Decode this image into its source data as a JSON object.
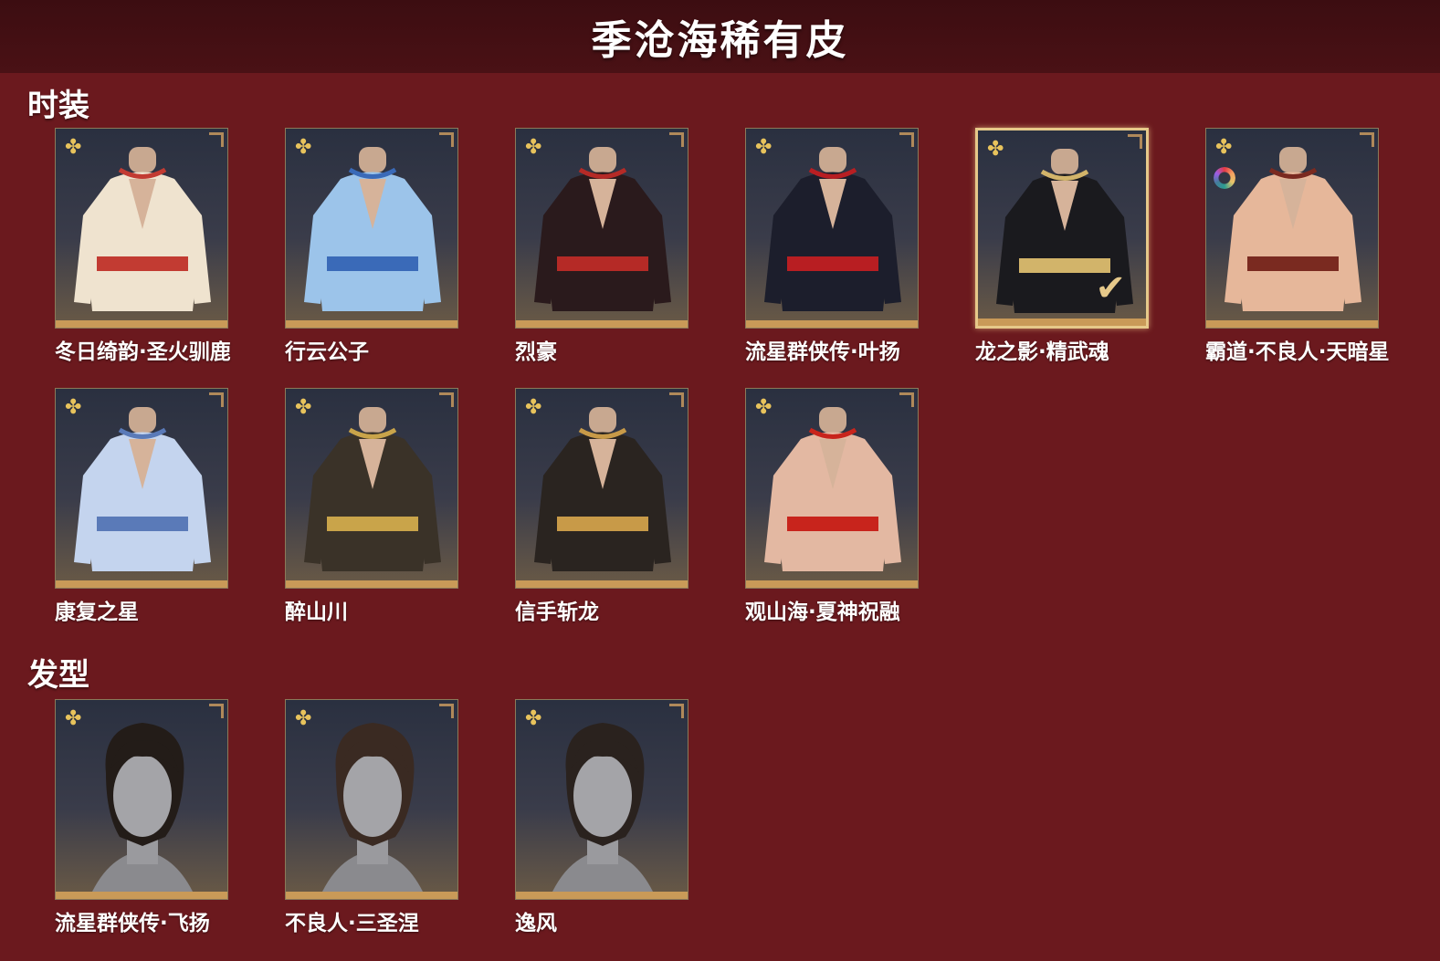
{
  "page": {
    "title": "季沧海稀有皮"
  },
  "sections": [
    {
      "title": "时装",
      "rows": [
        [
          {
            "name": "冬日绮韵·圣火驯鹿",
            "outfit": "#efe3cf",
            "accent": "#c23b32"
          },
          {
            "name": "行云公子",
            "outfit": "#9cc4ea",
            "accent": "#3a6ab8"
          },
          {
            "name": "烈豪",
            "outfit": "#2a1a1c",
            "accent": "#b52a26"
          },
          {
            "name": "流星群侠传·叶扬",
            "outfit": "#1c1e2c",
            "accent": "#b81e22"
          },
          {
            "name": "龙之影·精武魂",
            "outfit": "#1a1a1e",
            "accent": "#d2b46a",
            "selected": true
          },
          {
            "name": "霸道·不良人·天暗星",
            "outfit": "#e6b79a",
            "accent": "#7a2a20",
            "ring": true
          }
        ],
        [
          {
            "name": "康复之星",
            "outfit": "#c4d4ee",
            "accent": "#5a7ab8"
          },
          {
            "name": "醉山川",
            "outfit": "#3a3228",
            "accent": "#c9a44a"
          },
          {
            "name": "信手斩龙",
            "outfit": "#2a2420",
            "accent": "#c89a48"
          },
          {
            "name": "观山海·夏神祝融",
            "outfit": "#e3b8a2",
            "accent": "#c8241c"
          }
        ]
      ]
    },
    {
      "title": "发型",
      "rows": [
        [
          {
            "name": "流星群侠传·飞扬",
            "hair": "#231c18"
          },
          {
            "name": "不良人·三圣涅",
            "hair": "#3a2a22"
          },
          {
            "name": "逸风",
            "hair": "#2a221e"
          }
        ]
      ]
    }
  ],
  "icons": {
    "rarity": "flower-icon",
    "selected": "check-icon",
    "color": "color-ring-icon"
  }
}
